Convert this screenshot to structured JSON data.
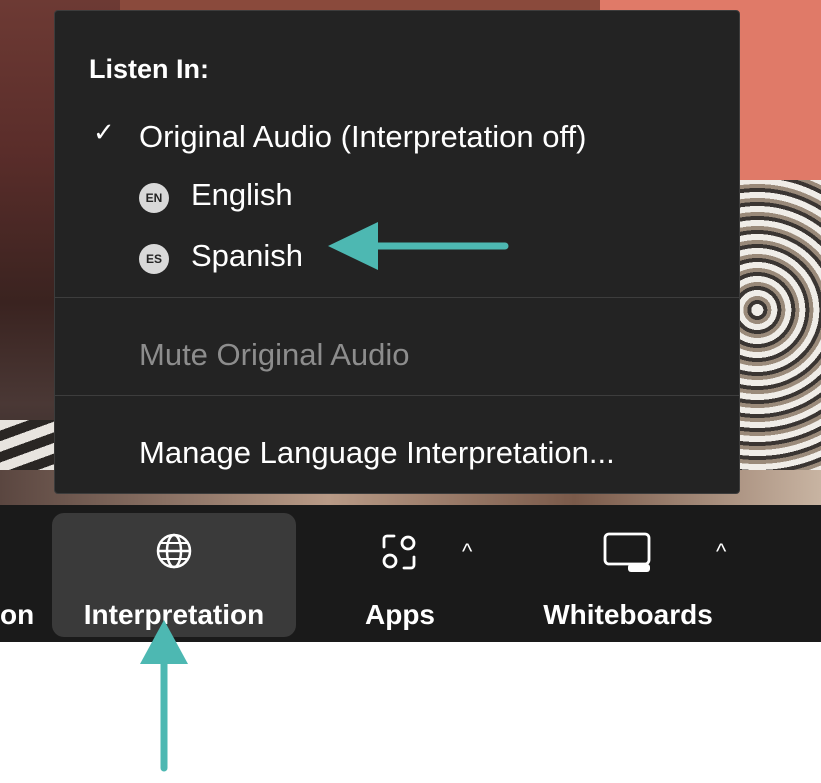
{
  "colors": {
    "menu_bg": "#232323",
    "toolbar_bg": "#1a1a1a",
    "active_btn_bg": "#3a3a3a",
    "annotation_arrow": "#4db8b2",
    "muted_text": "#8d8d8d"
  },
  "menu": {
    "heading": "Listen In:",
    "original_audio": {
      "label": "Original Audio (Interpretation off)",
      "checked": true,
      "check_glyph": "✓"
    },
    "languages": [
      {
        "code": "EN",
        "label": "English"
      },
      {
        "code": "ES",
        "label": "Spanish"
      }
    ],
    "mute_original": {
      "label": "Mute Original Audio",
      "enabled": false
    },
    "manage": {
      "label": "Manage Language Interpretation..."
    }
  },
  "toolbar": {
    "cut_label": "on",
    "items": [
      {
        "label": "Interpretation",
        "icon": "globe-icon",
        "active": true
      },
      {
        "label": "Apps",
        "icon": "apps-icon",
        "caret": "^"
      },
      {
        "label": "Whiteboards",
        "icon": "whiteboard-icon",
        "caret": "^"
      }
    ]
  }
}
